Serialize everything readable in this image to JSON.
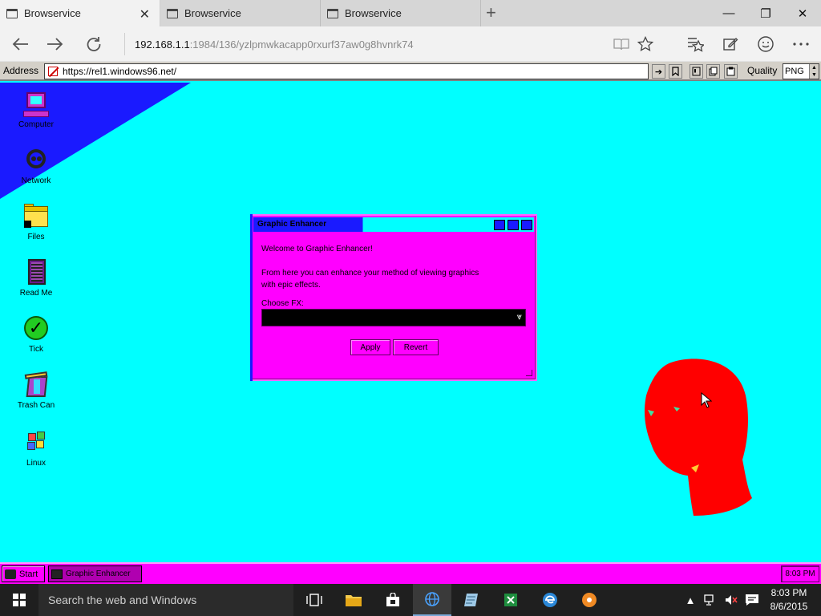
{
  "browser": {
    "tabs": [
      {
        "title": "Browservice"
      },
      {
        "title": "Browservice"
      },
      {
        "title": "Browservice"
      }
    ],
    "new_tab_symbol": "+",
    "window_controls": {
      "minimize": "—",
      "maximize": "❐",
      "close": "✕"
    },
    "url_host": "192.168.1.1",
    "url_path": ":1984/136/yzlpmwkacapp0rxurf37aw0g8hvnrk74"
  },
  "toolbar": {
    "address_label": "Address",
    "address_value": "https://rel1.windows96.net/",
    "quality_label": "Quality",
    "quality_value": "PNG"
  },
  "desktop": {
    "icons": [
      {
        "label": "Computer",
        "icon": "computer-icon"
      },
      {
        "label": "Network",
        "icon": "network-icon"
      },
      {
        "label": "Files",
        "icon": "folder-icon"
      },
      {
        "label": "Read Me",
        "icon": "readme-icon"
      },
      {
        "label": "Tick",
        "icon": "check-icon"
      },
      {
        "label": "Trash Can",
        "icon": "trash-icon"
      },
      {
        "label": "Linux",
        "icon": "logo-icon"
      }
    ]
  },
  "dialog": {
    "title": "Graphic Enhancer",
    "welcome": "Welcome to Graphic Enhancer!",
    "desc_line1": "From here you can enhance your method of viewing graphics",
    "desc_line2": "with epic effects.",
    "choose_label": "Choose FX:",
    "select_value": "",
    "apply_label": "Apply",
    "revert_label": "Revert"
  },
  "win96_taskbar": {
    "start_label": "Start",
    "task_label": "Graphic Enhancer",
    "clock": "8:03 PM"
  },
  "win10_taskbar": {
    "search_placeholder": "Search the web and Windows",
    "time": "8:03 PM",
    "date": "8/6/2015"
  },
  "colors": {
    "desktop": "#00ffff",
    "window_body": "#ff00ff",
    "titlebar_active": "#1a1aff",
    "head": "#ff0000"
  }
}
